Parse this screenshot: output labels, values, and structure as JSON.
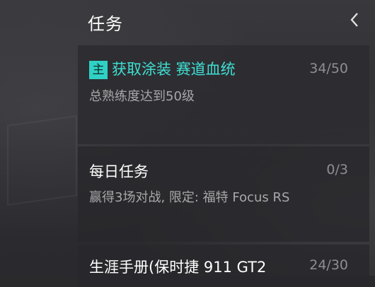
{
  "header": {
    "title": "任务",
    "collapse_icon": "chevron-left-icon"
  },
  "tasks": [
    {
      "tag": "主",
      "title": "获取涂装 赛道血统",
      "progress": "34/50",
      "desc": "总熟练度达到50级"
    },
    {
      "title": "每日任务",
      "progress": "0/3",
      "desc": "赢得3场对战, 限定: 福特 Focus RS"
    },
    {
      "title": "生涯手册(保时捷 911 GT2",
      "progress": "24/30"
    }
  ],
  "colors": {
    "accent": "#2fd1c4",
    "main_title": "#3fe0d2"
  }
}
